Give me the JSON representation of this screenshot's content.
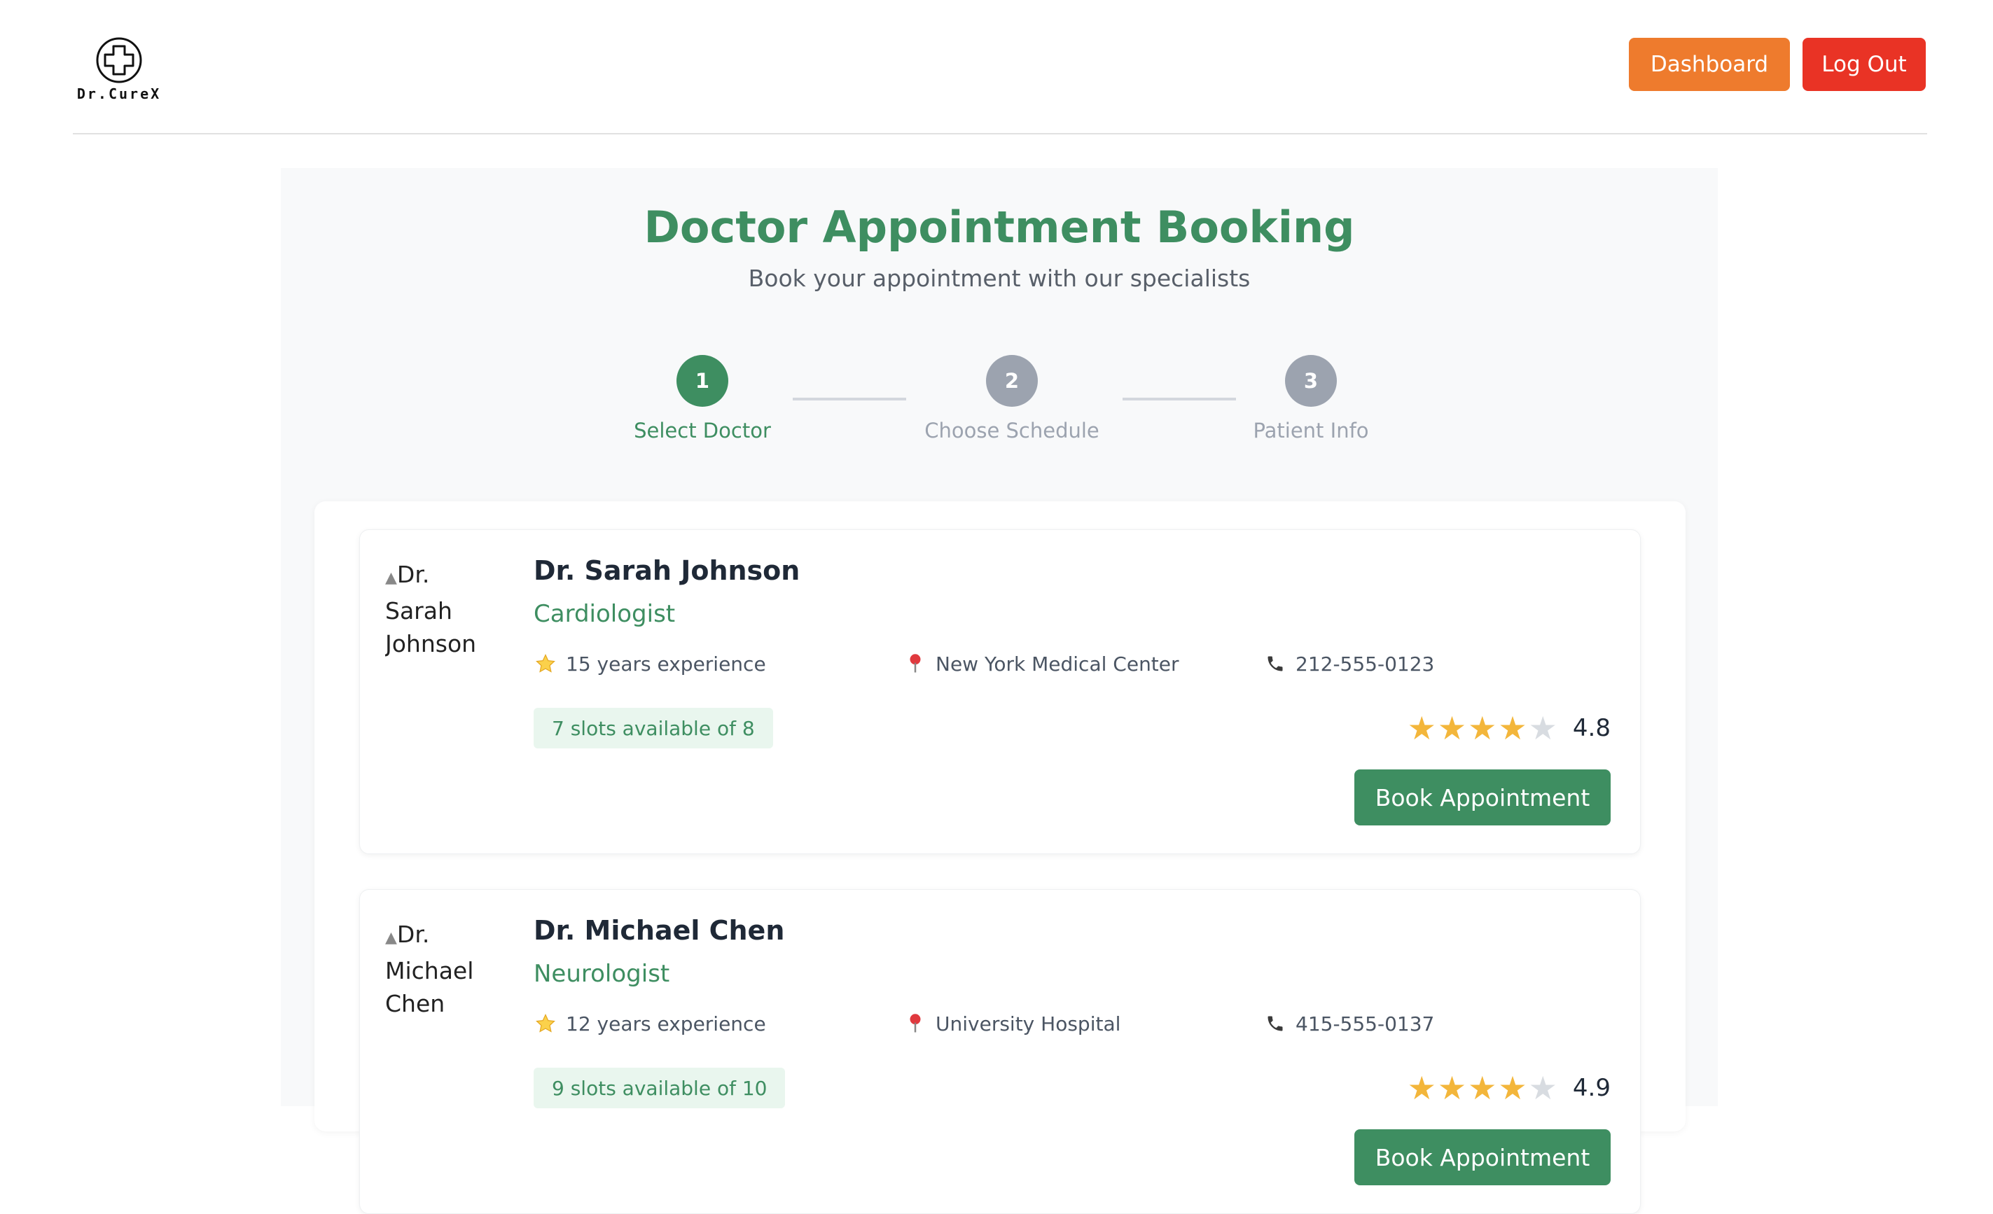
{
  "header": {
    "logo_text": "Dr.CureX",
    "dashboard_label": "Dashboard",
    "logout_label": "Log Out"
  },
  "booking": {
    "title": "Doctor Appointment Booking",
    "subtitle": "Book your appointment with our specialists"
  },
  "steps": [
    {
      "number": "1",
      "label": "Select Doctor",
      "state": "active"
    },
    {
      "number": "2",
      "label": "Choose Schedule",
      "state": "inactive"
    },
    {
      "number": "3",
      "label": "Patient Info",
      "state": "inactive"
    }
  ],
  "doctors": [
    {
      "photo_alt_lines": [
        "Dr.",
        "Sarah",
        "Johnson"
      ],
      "name": "Dr. Sarah Johnson",
      "specialty": "Cardiologist",
      "experience": "15 years experience",
      "location": "New York Medical Center",
      "phone": "212-555-0123",
      "slots": "7 slots available of 8",
      "stars_filled": 4,
      "stars_total": 5,
      "rating": "4.8",
      "book_label": "Book Appointment"
    },
    {
      "photo_alt_lines": [
        "Dr.",
        "Michael",
        "Chen"
      ],
      "name": "Dr. Michael Chen",
      "specialty": "Neurologist",
      "experience": "12 years experience",
      "location": "University Hospital",
      "phone": "415-555-0137",
      "slots": "9 slots available of 10",
      "stars_filled": 4,
      "stars_total": 5,
      "rating": "4.9",
      "book_label": "Book Appointment"
    }
  ],
  "colors": {
    "brand_green": "#3e8e61",
    "dashboard_orange": "#ee7b2d",
    "logout_red": "#e93325",
    "step_inactive": "#9ca3af",
    "star_gold": "#f3b63b"
  },
  "icons": {
    "experience": "star-icon",
    "location": "map-pin-icon",
    "phone": "phone-icon"
  }
}
